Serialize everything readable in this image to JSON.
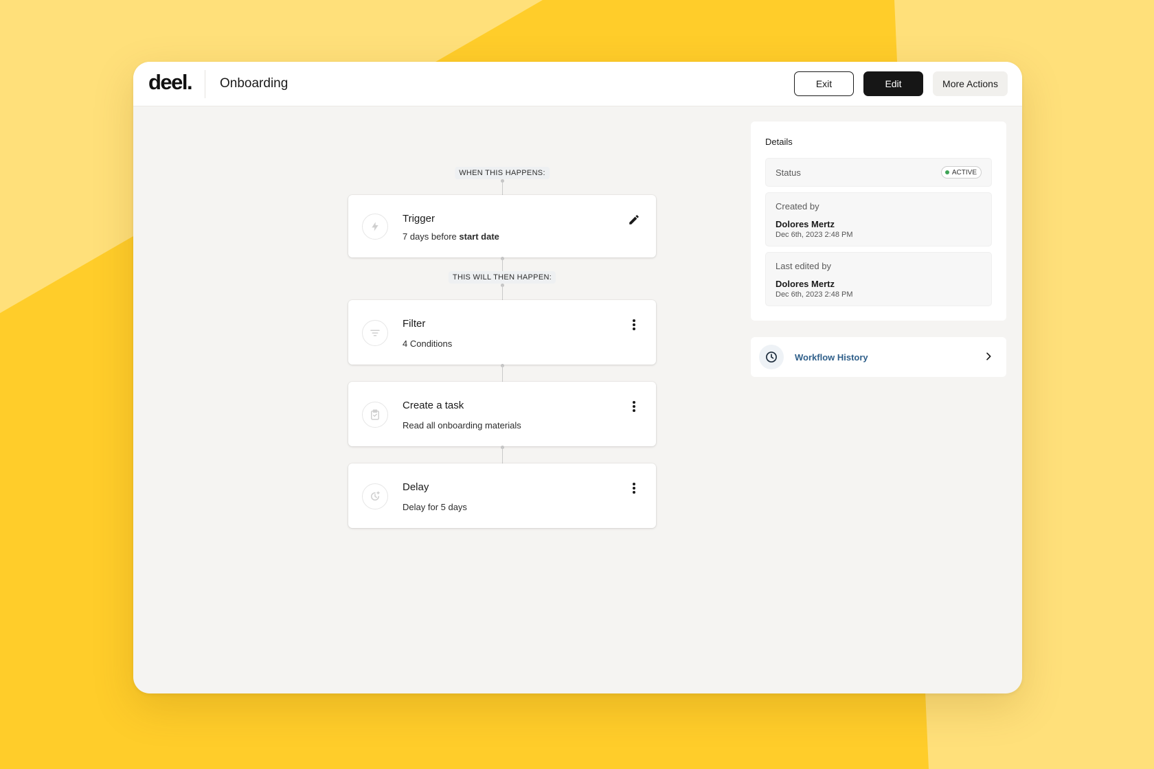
{
  "app": {
    "logo": "deel.",
    "page_title": "Onboarding"
  },
  "header": {
    "exit_label": "Exit",
    "edit_label": "Edit",
    "more_label": "More Actions"
  },
  "flow": {
    "trigger_heading": "WHEN THIS HAPPENS:",
    "then_heading": "THIS WILL THEN HAPPEN:",
    "trigger": {
      "title": "Trigger",
      "sub_prefix": "7 days before ",
      "sub_bold": "start date",
      "icon": "lightning-icon",
      "action_icon": "pencil-icon"
    },
    "steps": [
      {
        "title": "Filter",
        "sub": "4 Conditions",
        "icon": "filter-icon",
        "action_icon": "kebab-icon"
      },
      {
        "title": "Create a task",
        "sub": "Read all onboarding materials",
        "icon": "task-check-icon",
        "action_icon": "kebab-icon"
      },
      {
        "title": "Delay",
        "sub": "Delay for 5 days",
        "icon": "delay-clock-icon",
        "action_icon": "kebab-icon"
      }
    ]
  },
  "details": {
    "title": "Details",
    "status_label": "Status",
    "status_value": "ACTIVE",
    "created_label": "Created by",
    "created_name": "Dolores Mertz",
    "created_date": "Dec 6th, 2023 2:48 PM",
    "edited_label": "Last edited by",
    "edited_name": "Dolores Mertz",
    "edited_date": "Dec 6th, 2023 2:48 PM"
  },
  "history": {
    "label": "Workflow History",
    "icon": "clock-icon"
  },
  "colors": {
    "background": "#ffcd2a",
    "background_light": "#ffe07a",
    "accent_link": "#2f5f8a",
    "status_active": "#3fa456",
    "primary_button": "#161616"
  }
}
